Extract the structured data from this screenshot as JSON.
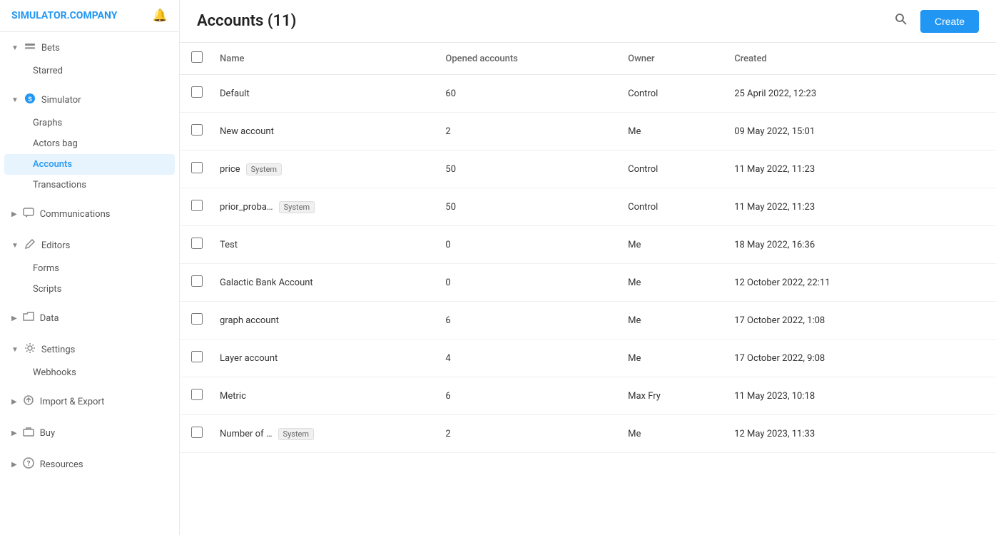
{
  "app": {
    "logo_main": "SIMULATOR",
    "logo_accent": ".COMPANY"
  },
  "sidebar": {
    "groups": [
      {
        "id": "bets",
        "label": "Bets",
        "icon": "layers-icon",
        "expanded": true,
        "children": [
          {
            "id": "starred",
            "label": "Starred",
            "active": false
          }
        ]
      },
      {
        "id": "simulator",
        "label": "Simulator",
        "icon": "simulator-icon",
        "expanded": true,
        "children": [
          {
            "id": "graphs",
            "label": "Graphs",
            "active": false
          },
          {
            "id": "actors-bag",
            "label": "Actors bag",
            "active": false
          },
          {
            "id": "accounts",
            "label": "Accounts",
            "active": true
          },
          {
            "id": "transactions",
            "label": "Transactions",
            "active": false
          }
        ]
      },
      {
        "id": "communications",
        "label": "Communications",
        "icon": "chat-icon",
        "expanded": false,
        "children": []
      },
      {
        "id": "editors",
        "label": "Editors",
        "icon": "pencil-icon",
        "expanded": true,
        "children": [
          {
            "id": "forms",
            "label": "Forms",
            "active": false
          },
          {
            "id": "scripts",
            "label": "Scripts",
            "active": false
          }
        ]
      },
      {
        "id": "data",
        "label": "Data",
        "icon": "folder-icon",
        "expanded": false,
        "children": []
      },
      {
        "id": "settings",
        "label": "Settings",
        "icon": "gear-icon",
        "expanded": true,
        "children": [
          {
            "id": "webhooks",
            "label": "Webhooks",
            "active": false
          }
        ]
      },
      {
        "id": "import-export",
        "label": "Import & Export",
        "icon": "arrows-icon",
        "expanded": false,
        "children": []
      },
      {
        "id": "buy",
        "label": "Buy",
        "icon": "briefcase-icon",
        "expanded": false,
        "children": []
      },
      {
        "id": "resources",
        "label": "Resources",
        "icon": "question-icon",
        "expanded": false,
        "children": []
      }
    ]
  },
  "header": {
    "title": "Accounts (11)",
    "create_label": "Create"
  },
  "table": {
    "columns": [
      "Name",
      "Opened accounts",
      "Owner",
      "Created"
    ],
    "rows": [
      {
        "id": 1,
        "name": "Default",
        "badge": null,
        "opened_accounts": "60",
        "owner": "Control",
        "created": "25 April 2022, 12:23"
      },
      {
        "id": 2,
        "name": "New account",
        "badge": null,
        "opened_accounts": "2",
        "owner": "Me",
        "created": "09 May 2022, 15:01"
      },
      {
        "id": 3,
        "name": "price",
        "badge": "System",
        "opened_accounts": "50",
        "owner": "Control",
        "created": "11 May 2022, 11:23"
      },
      {
        "id": 4,
        "name": "prior_proba…",
        "badge": "System",
        "opened_accounts": "50",
        "owner": "Control",
        "created": "11 May 2022, 11:23"
      },
      {
        "id": 5,
        "name": "Test",
        "badge": null,
        "opened_accounts": "0",
        "owner": "Me",
        "created": "18 May 2022, 16:36"
      },
      {
        "id": 6,
        "name": "Galactic Bank Account",
        "badge": null,
        "opened_accounts": "0",
        "owner": "Me",
        "created": "12 October 2022, 22:11"
      },
      {
        "id": 7,
        "name": "graph account",
        "badge": null,
        "opened_accounts": "6",
        "owner": "Me",
        "created": "17 October 2022, 1:08"
      },
      {
        "id": 8,
        "name": "Layer account",
        "badge": null,
        "opened_accounts": "4",
        "owner": "Me",
        "created": "17 October 2022, 9:08"
      },
      {
        "id": 9,
        "name": "Metric",
        "badge": null,
        "opened_accounts": "6",
        "owner": "Max Fry",
        "created": "11 May 2023, 10:18"
      },
      {
        "id": 10,
        "name": "Number of …",
        "badge": "System",
        "opened_accounts": "2",
        "owner": "Me",
        "created": "12 May 2023, 11:33"
      }
    ]
  }
}
